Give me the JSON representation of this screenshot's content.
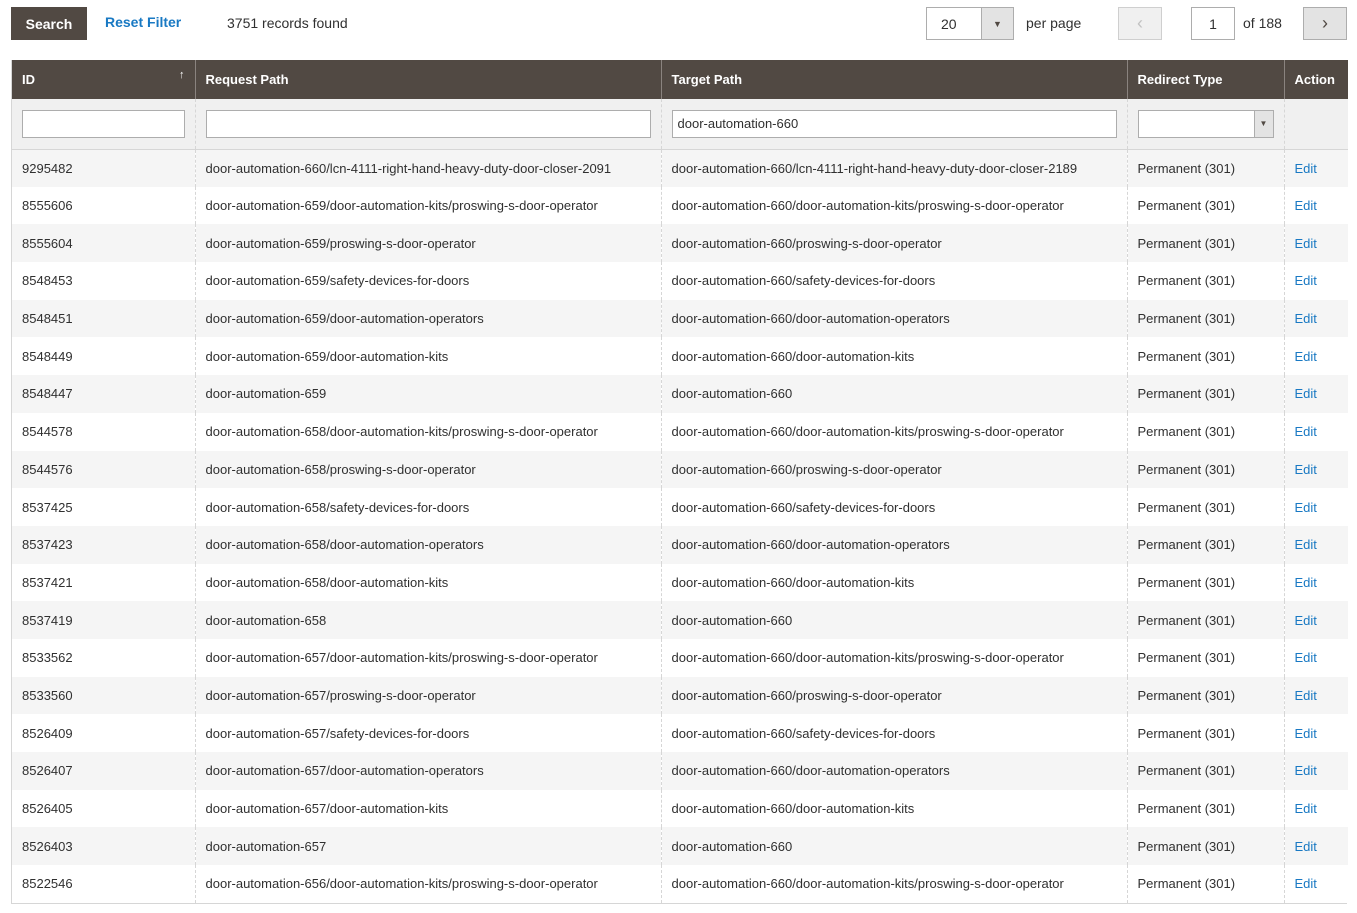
{
  "toolbar": {
    "search_label": "Search",
    "reset_filter_label": "Reset Filter",
    "records_found": "3751 records found",
    "per_page_value": "20",
    "per_page_label": "per page",
    "prev_icon": "‹",
    "next_icon": "›",
    "current_page": "1",
    "page_of": "of 188"
  },
  "grid": {
    "columns": [
      {
        "key": "id",
        "label": "ID",
        "sorted": "ascending"
      },
      {
        "key": "request_path",
        "label": "Request Path"
      },
      {
        "key": "target_path",
        "label": "Target Path"
      },
      {
        "key": "redirect_type",
        "label": "Redirect Type"
      },
      {
        "key": "action",
        "label": "Action"
      }
    ],
    "sort_icon": "↑",
    "filters": {
      "id": "",
      "request_path": "",
      "target_path": "door-automation-660",
      "redirect_type": ""
    },
    "rows": [
      {
        "id": "9295482",
        "request_path": "door-automation-660/lcn-4111-right-hand-heavy-duty-door-closer-2091",
        "target_path": "door-automation-660/lcn-4111-right-hand-heavy-duty-door-closer-2189",
        "redirect_type": "Permanent (301)",
        "action": "Edit"
      },
      {
        "id": "8555606",
        "request_path": "door-automation-659/door-automation-kits/proswing-s-door-operator",
        "target_path": "door-automation-660/door-automation-kits/proswing-s-door-operator",
        "redirect_type": "Permanent (301)",
        "action": "Edit"
      },
      {
        "id": "8555604",
        "request_path": "door-automation-659/proswing-s-door-operator",
        "target_path": "door-automation-660/proswing-s-door-operator",
        "redirect_type": "Permanent (301)",
        "action": "Edit"
      },
      {
        "id": "8548453",
        "request_path": "door-automation-659/safety-devices-for-doors",
        "target_path": "door-automation-660/safety-devices-for-doors",
        "redirect_type": "Permanent (301)",
        "action": "Edit"
      },
      {
        "id": "8548451",
        "request_path": "door-automation-659/door-automation-operators",
        "target_path": "door-automation-660/door-automation-operators",
        "redirect_type": "Permanent (301)",
        "action": "Edit"
      },
      {
        "id": "8548449",
        "request_path": "door-automation-659/door-automation-kits",
        "target_path": "door-automation-660/door-automation-kits",
        "redirect_type": "Permanent (301)",
        "action": "Edit"
      },
      {
        "id": "8548447",
        "request_path": "door-automation-659",
        "target_path": "door-automation-660",
        "redirect_type": "Permanent (301)",
        "action": "Edit"
      },
      {
        "id": "8544578",
        "request_path": "door-automation-658/door-automation-kits/proswing-s-door-operator",
        "target_path": "door-automation-660/door-automation-kits/proswing-s-door-operator",
        "redirect_type": "Permanent (301)",
        "action": "Edit"
      },
      {
        "id": "8544576",
        "request_path": "door-automation-658/proswing-s-door-operator",
        "target_path": "door-automation-660/proswing-s-door-operator",
        "redirect_type": "Permanent (301)",
        "action": "Edit"
      },
      {
        "id": "8537425",
        "request_path": "door-automation-658/safety-devices-for-doors",
        "target_path": "door-automation-660/safety-devices-for-doors",
        "redirect_type": "Permanent (301)",
        "action": "Edit"
      },
      {
        "id": "8537423",
        "request_path": "door-automation-658/door-automation-operators",
        "target_path": "door-automation-660/door-automation-operators",
        "redirect_type": "Permanent (301)",
        "action": "Edit"
      },
      {
        "id": "8537421",
        "request_path": "door-automation-658/door-automation-kits",
        "target_path": "door-automation-660/door-automation-kits",
        "redirect_type": "Permanent (301)",
        "action": "Edit"
      },
      {
        "id": "8537419",
        "request_path": "door-automation-658",
        "target_path": "door-automation-660",
        "redirect_type": "Permanent (301)",
        "action": "Edit"
      },
      {
        "id": "8533562",
        "request_path": "door-automation-657/door-automation-kits/proswing-s-door-operator",
        "target_path": "door-automation-660/door-automation-kits/proswing-s-door-operator",
        "redirect_type": "Permanent (301)",
        "action": "Edit"
      },
      {
        "id": "8533560",
        "request_path": "door-automation-657/proswing-s-door-operator",
        "target_path": "door-automation-660/proswing-s-door-operator",
        "redirect_type": "Permanent (301)",
        "action": "Edit"
      },
      {
        "id": "8526409",
        "request_path": "door-automation-657/safety-devices-for-doors",
        "target_path": "door-automation-660/safety-devices-for-doors",
        "redirect_type": "Permanent (301)",
        "action": "Edit"
      },
      {
        "id": "8526407",
        "request_path": "door-automation-657/door-automation-operators",
        "target_path": "door-automation-660/door-automation-operators",
        "redirect_type": "Permanent (301)",
        "action": "Edit"
      },
      {
        "id": "8526405",
        "request_path": "door-automation-657/door-automation-kits",
        "target_path": "door-automation-660/door-automation-kits",
        "redirect_type": "Permanent (301)",
        "action": "Edit"
      },
      {
        "id": "8526403",
        "request_path": "door-automation-657",
        "target_path": "door-automation-660",
        "redirect_type": "Permanent (301)",
        "action": "Edit"
      },
      {
        "id": "8522546",
        "request_path": "door-automation-656/door-automation-kits/proswing-s-door-operator",
        "target_path": "door-automation-660/door-automation-kits/proswing-s-door-operator",
        "redirect_type": "Permanent (301)",
        "action": "Edit"
      }
    ]
  },
  "colors": {
    "header_bg": "#514943",
    "link": "#1979c3",
    "row_alt": "#f5f5f5"
  }
}
